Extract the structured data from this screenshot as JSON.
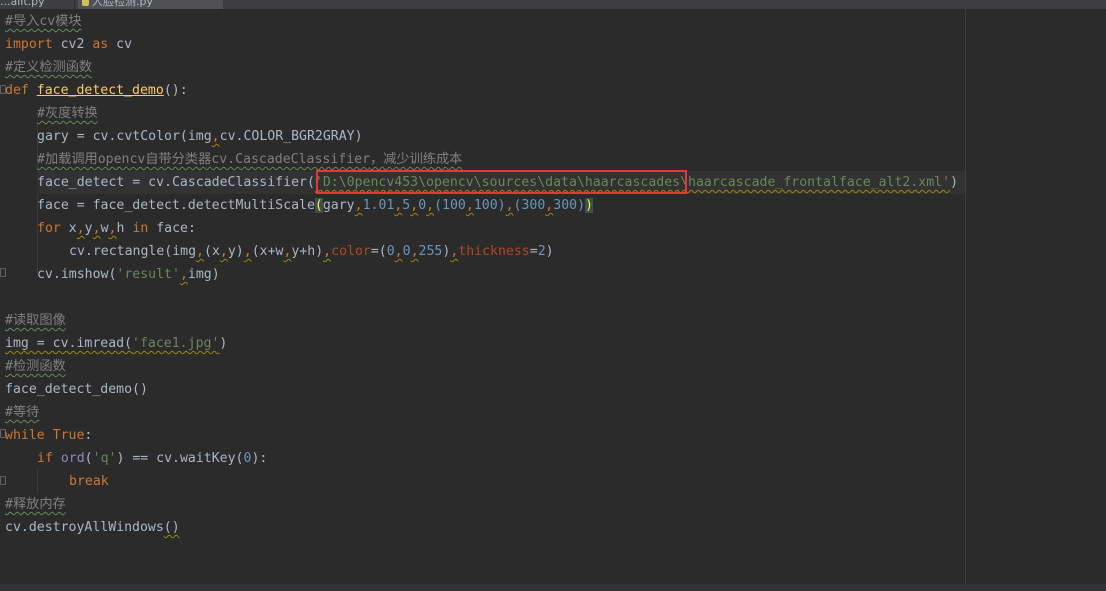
{
  "tabs": [
    {
      "label": "...ailt.py"
    },
    {
      "label": "人脸检测.py"
    }
  ],
  "code": {
    "l1": "#导入cv模块",
    "l2a": "import",
    "l2b": " cv2 ",
    "l2c": "as",
    "l2d": " cv",
    "l3": "#定义检测函数",
    "l4a": "def",
    "l4b": " ",
    "l4c": "face_detect_demo",
    "l4d": "():",
    "l5": "#灰度转换",
    "l6a": "gary = cv.cvtColor(img",
    "l6b": ",",
    "l6c": "cv.COLOR_BGR2GRAY)",
    "l7a": "#加载调用opencv自带分类器",
    "l7b": "cv.CascadeClassifier",
    "l7c": "，减少训练成本",
    "l8a": "face_detect = cv.CascadeClassifier(",
    "l8b": "'D:\\0pencv453\\opencv\\sources\\data\\haarcascades\\haarcascade_frontalface_alt2.xml'",
    "l8c": ")",
    "l9a": "face = face_detect.detectMultiScale",
    "l9b": "(",
    "l9c": "gary",
    "l9d": ",",
    "l9e": "1.01",
    "l9f": ",",
    "l9g": "5",
    "l9h": ",",
    "l9i": "0",
    "l9j": ",",
    "l9k": "(100",
    "l9l": ",",
    "l9m": "100)",
    "l9n": ",",
    "l9o": "(300",
    "l9p": ",",
    "l9q": "300)",
    "l9r": ")",
    "l10a": "for",
    "l10b": " x",
    "l10c": ",",
    "l10d": "y",
    "l10e": ",",
    "l10f": "w",
    "l10g": ",",
    "l10h": "h ",
    "l10i": "in",
    "l10j": " face:",
    "l11a": "cv.rectangle(img",
    "l11b": ",",
    "l11c": "(x",
    "l11d": ",",
    "l11e": "y)",
    "l11f": ",",
    "l11g": "(x+w",
    "l11h": ",",
    "l11i": "y+h)",
    "l11j": ",",
    "l11k": "color",
    "l11l": "=(",
    "l11m": "0",
    "l11n": ",",
    "l11o": "0",
    "l11p": ",",
    "l11q": "255",
    "l11r": ")",
    "l11s": ",",
    "l11t": "thickness",
    "l11u": "=",
    "l11v": "2",
    "l11w": ")",
    "l12a": "cv.imshow(",
    "l12b": "'result'",
    "l12c": ",",
    "l12d": "img)",
    "l14": "#读取图像",
    "l15a": "img = cv.imread(",
    "l15b": "'face1.jpg'",
    "l15c": ")",
    "l16": "#检测函数",
    "l17": "face_detect_demo()",
    "l18": "#等待",
    "l19a": "while",
    "l19b": " ",
    "l19c": "True",
    "l19d": ":",
    "l20a": "if",
    "l20b": " ",
    "l20c": "ord",
    "l20d": "(",
    "l20e": "'q'",
    "l20f": ") == cv.waitKey(",
    "l20g": "0",
    "l20h": "):",
    "l21": "break",
    "l22": "#释放内存",
    "l23a": "cv.destroyAllWindows",
    "l23b": "()"
  },
  "colors": {
    "background": "#2b2b2b",
    "keyword": "#cc7832",
    "string": "#6a8759",
    "number": "#6897bb",
    "comment": "#808080",
    "function": "#ffc66d",
    "highlight_box": "#e53935"
  }
}
